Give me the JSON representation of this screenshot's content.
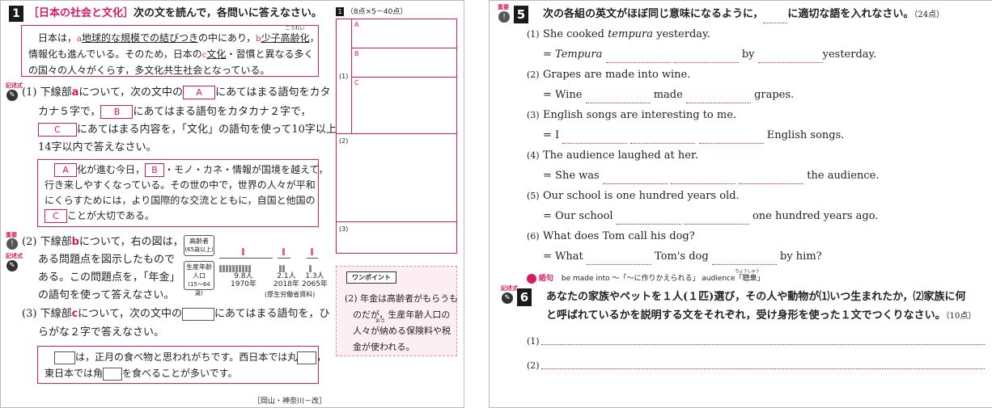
{
  "left": {
    "q1_num": "1",
    "q1_title": "［日本の社会と文化］",
    "q1_instruction": "次の文を読んで，各問いに答えなさい。",
    "passage_line1_a": "日本は，",
    "passage_a_mark": "a",
    "passage_line1_b": "地球的な規模での結びつき",
    "passage_line1_c": "の中にあり，",
    "passage_b_mark": "b",
    "passage_line1_d": "少子高齢化",
    "passage_ruby": "こうれい",
    "passage_line1_e": "，",
    "passage_line2": "情報化も進んでいる。そのため，日本の",
    "passage_c_mark": "c",
    "passage_line2_b": "文化",
    "passage_line2_c": "・習慣と異なる多く",
    "passage_line3": "の国々の人々がくらす，多文化共生社会となっている。",
    "tag_kijutsu": "記述式",
    "tag_juyo": "重要",
    "q1_1_label": "(1)",
    "q1_1_line1_a": "下線部",
    "q1_1_line1_b": "について，次の文中の",
    "q1_1_line1_c": "にあてはまる語句をカタ",
    "q1_1_line2_a": "カナ５字で，",
    "q1_1_line2_b": "にあてはまる語句をカタカナ２字で，",
    "q1_1_line3": "にあてはまる内容を，「文化」の語句を使って10字以上",
    "q1_1_line4": "14字以内で答えなさい。",
    "box_A": "A",
    "box_B": "B",
    "box_C": "C",
    "sub1_line1_a": "化が進む今日，",
    "sub1_line1_b": "・モノ・カネ・情報が国境を越えて，",
    "sub1_line2": "行き来しやすくなっている。その世の中で，世界の人々が平和",
    "sub1_line3": "にくらすためには，より国際的な交流とともに，自国と他国の",
    "sub1_line4": "ことが大切である。",
    "q1_2_label": "(2)",
    "q1_2_line1_a": "下線部",
    "q1_2_line1_b": "について，右の図は，",
    "q1_2_line2": "ある問題点を図示したもので",
    "q1_2_line3": "ある。この問題点を，「年金」",
    "q1_2_line4": "の語句を使って答えなさい。",
    "fig_elder_label_1": "高齢者",
    "fig_elder_label_2": "(65歳以上)",
    "fig_work_label_1": "生産年齢",
    "fig_work_label_2": "人口",
    "fig_work_label_3": "(15～64歳)",
    "fig_1970_val": "9.8人",
    "fig_1970_year": "1970年",
    "fig_2018_val": "2.1人",
    "fig_2018_year": "2018年",
    "fig_2065_val": "1.3人",
    "fig_2065_year": "2065年",
    "fig_source": "(厚生労働省資料)",
    "q1_3_label": "(3)",
    "q1_3_line1_a": "下線部",
    "q1_3_line1_b": "について，次の文中の",
    "q1_3_line1_c": "にあてはまる語句を，ひ",
    "q1_3_line2": "らがな２字で答えなさい。",
    "sub3_line1_a": "は，正月の食べ物と思われがちです。西日本では丸",
    "sub3_line1_b": "，",
    "sub3_line2_a": "東日本では角",
    "sub3_line2_b": "を食べることが多いです。",
    "source_note": "［岡山・神奈川－改］",
    "grid_num": "1",
    "grid_points": "（8点×5－40点）",
    "grid_q1": "(1)",
    "grid_q2": "(2)",
    "grid_q3": "(3)",
    "onepoint_title": "ワンポイント",
    "onepoint_line1": "(2) 年金は高齢者がもらうも",
    "onepoint_line2": "のだが，生産年齢人口の",
    "onepoint_line3": "人々が納める保険料や税",
    "onepoint_ruby": "おさ",
    "onepoint_line4": "金が使われる。"
  },
  "right": {
    "q5_num": "5",
    "q5_tag": "重要",
    "q5_instruction_a": "次の各組の英文がほぼ同じ意味になるように，",
    "q5_instruction_b": "に適切な語を入れなさい。",
    "q5_points": "（24点）",
    "items": [
      {
        "n": "(1)",
        "s1": "She cooked ",
        "s1_it": "tempura",
        "s1_end": " yesterday.",
        "eq": "=",
        "s2_it": "Tempura",
        "mid1": "",
        "mid2": "by",
        "end": "yesterday."
      },
      {
        "n": "(2)",
        "s1": "Grapes are made into wine.",
        "eq": "=",
        "s2": "Wine",
        "mid1": "made",
        "end": "grapes."
      },
      {
        "n": "(3)",
        "s1": "English songs are interesting to me.",
        "eq": "=",
        "s2": "I",
        "end": "English songs."
      },
      {
        "n": "(4)",
        "s1": "The audience laughed at her.",
        "eq": "=",
        "s2": "She was",
        "end": "the audience."
      },
      {
        "n": "(5)",
        "s1": "Our school is one hundred years old.",
        "eq": "=",
        "s2": "Our school",
        "end": "one hundred years ago."
      },
      {
        "n": "(6)",
        "s1": "What does Tom call his dog?",
        "eq": "=",
        "s2": "What",
        "mid1": "Tom's dog",
        "end": "by him?"
      }
    ],
    "goku_label": "語句",
    "goku_text_a": "be made into ～「～に作りかえられる」 audience「聴衆」",
    "goku_ruby": "ちょうしゅう",
    "q6_num": "6",
    "q6_tag": "記述式",
    "q6_line1": "あなたの家族やペットを１人(１匹)選び，その人や動物が⑴いつ生まれたか，⑵家族に何",
    "q6_line2": "と呼ばれているかを説明する文をそれぞれ，受け身形を使った１文でつくりなさい。",
    "q6_points": "（10点）",
    "q6_a1": "(1)",
    "q6_a2": "(2)"
  }
}
